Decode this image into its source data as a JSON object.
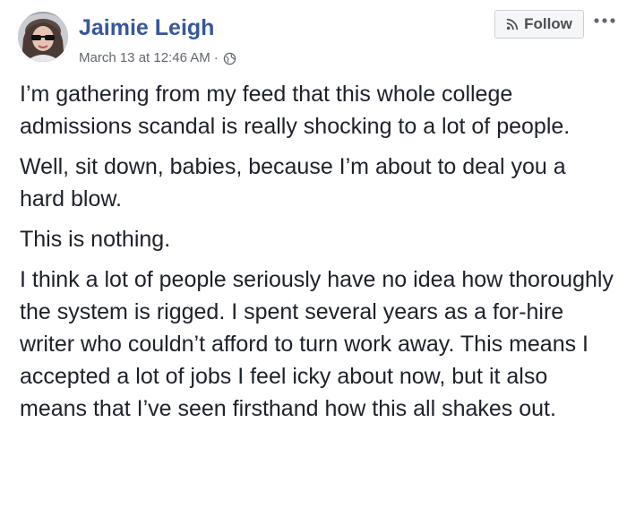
{
  "post": {
    "author": "Jaimie Leigh",
    "timestamp": "March 13 at 12:46 AM",
    "separator": "·",
    "privacy_icon": "globe-icon",
    "follow_label": "Follow",
    "follow_icon": "rss-icon",
    "more_icon": "more-options-icon",
    "paragraphs": [
      "I’m gathering from my feed that this whole college admissions scandal is really shocking to a lot of people.",
      "Well, sit down, babies, because I’m about to deal you a hard blow.",
      "This is nothing.",
      "I think a lot of people seriously have no idea how thoroughly the system is rigged. I spent several years as a for-hire writer who couldn’t afford to turn work away. This means I accepted a lot of jobs I feel icky about now, but it also means that I’ve seen firsthand how this all shakes out."
    ]
  },
  "colors": {
    "author_name": "#365899",
    "meta_text": "#616770",
    "body_text": "#1d2129",
    "button_bg": "#f5f6f7",
    "button_border": "#ccd0d5"
  }
}
